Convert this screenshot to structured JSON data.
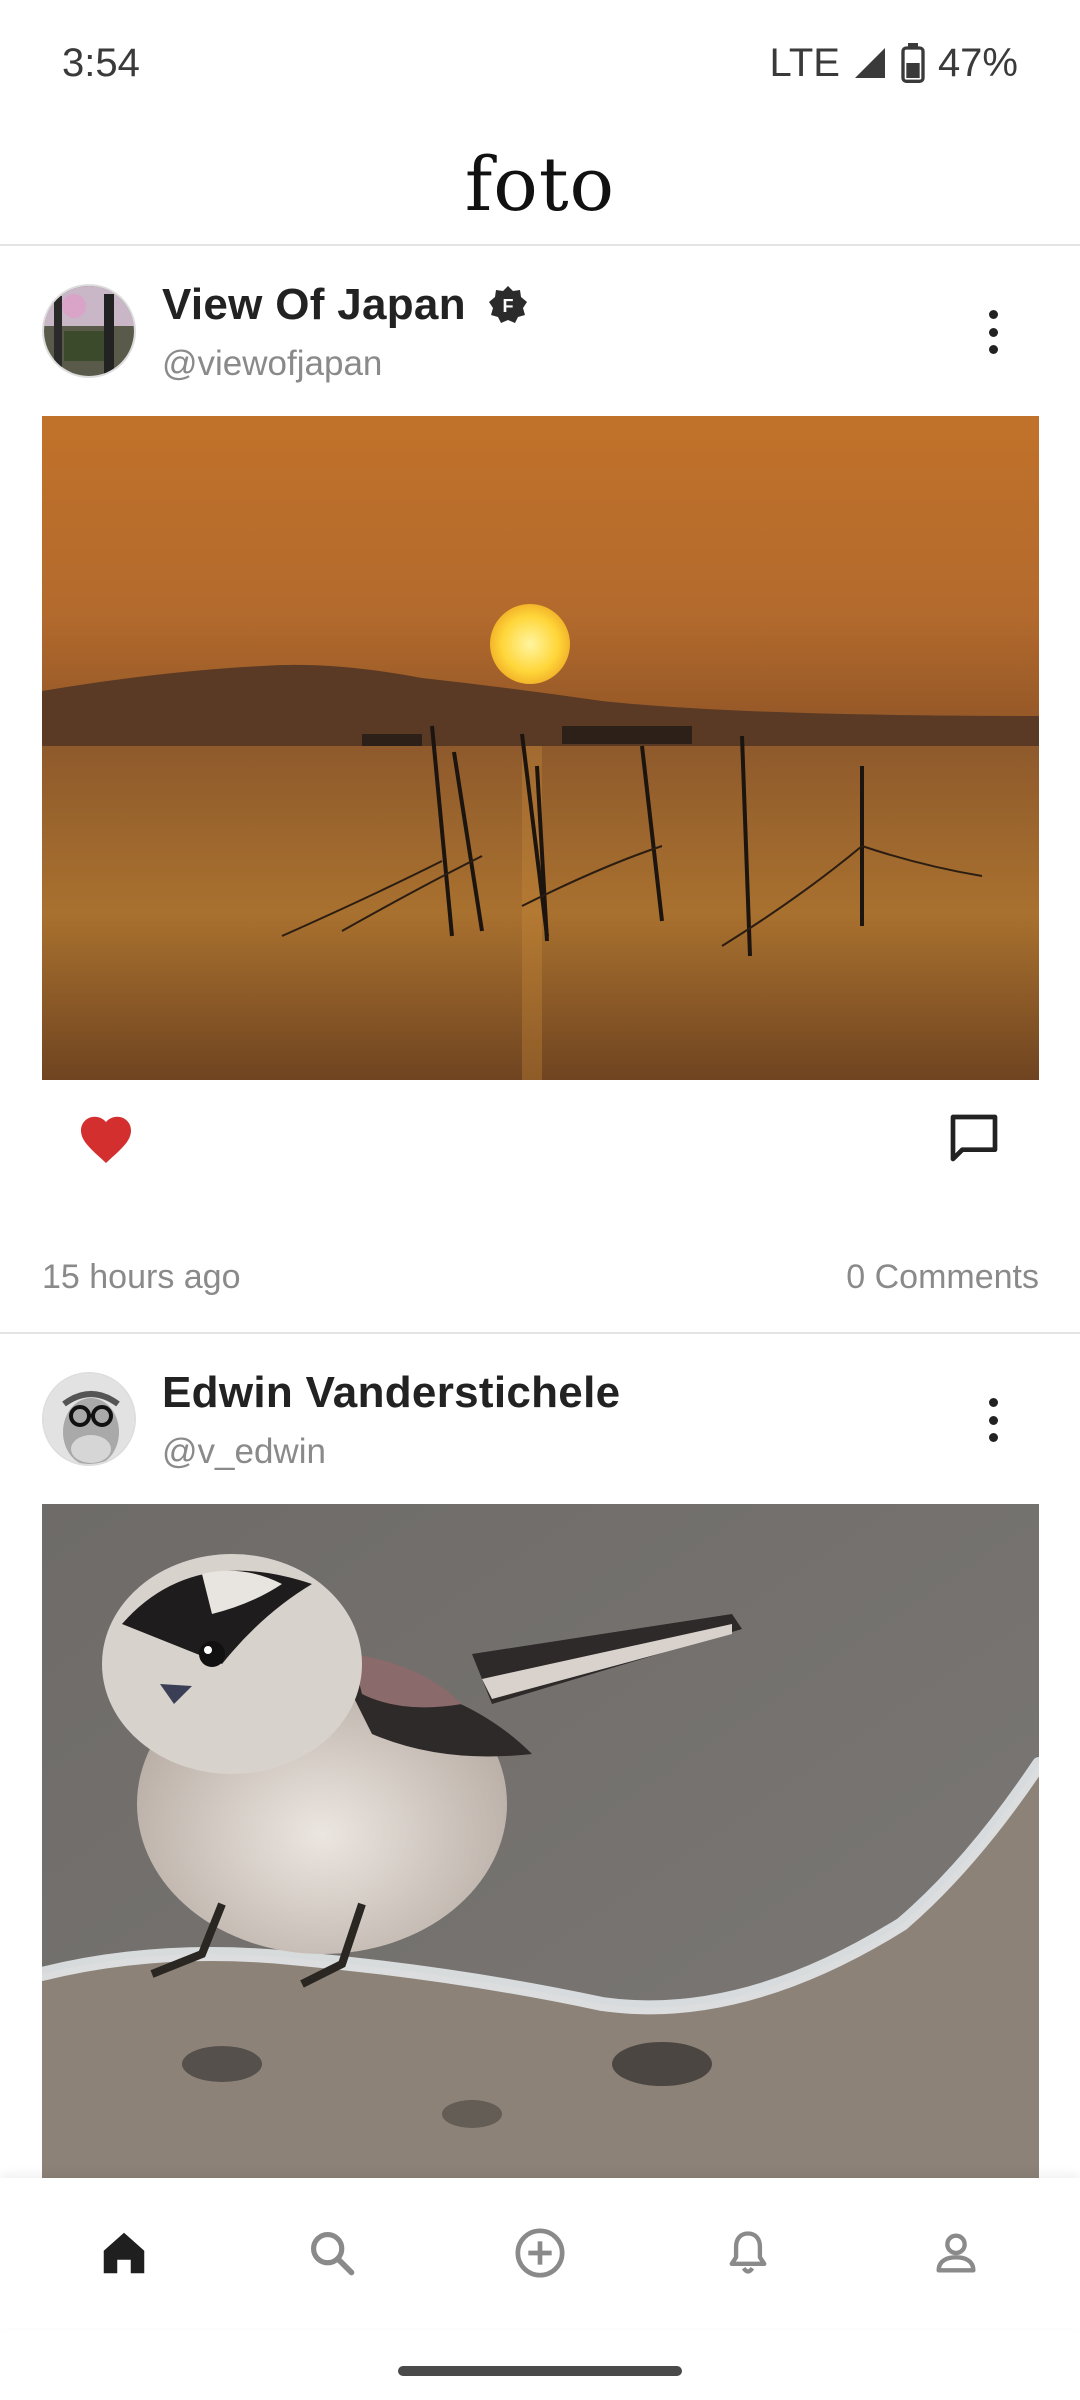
{
  "status_bar": {
    "time": "3:54",
    "network": "LTE",
    "battery": "47%"
  },
  "app": {
    "title": "foto"
  },
  "posts": [
    {
      "display_name": "View Of Japan",
      "handle": "@viewofjapan",
      "verified_badge": "F",
      "image": "sunset over sea with fishing poles",
      "liked": true,
      "time_ago": "15 hours ago",
      "comments": "0 Comments"
    },
    {
      "display_name": "Edwin Vanderstichele",
      "handle": "@v_edwin",
      "image": "small bird on frosty branch"
    }
  ],
  "bottom_nav": {
    "items": [
      "home-icon",
      "search-icon",
      "add-circle-icon",
      "bell-icon",
      "profile-icon"
    ],
    "active": "home-icon"
  },
  "colors": {
    "like": "#d32f2f",
    "text_primary": "#222222",
    "text_secondary": "#8a8a8a",
    "divider": "#e4e4e4"
  }
}
